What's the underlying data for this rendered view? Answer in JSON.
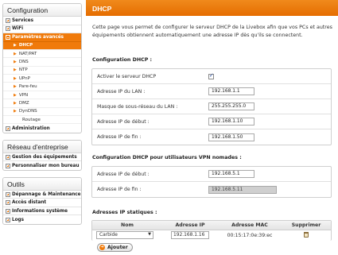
{
  "sidebar": {
    "config": {
      "title": "Configuration",
      "items": [
        {
          "label": "Services"
        },
        {
          "label": "WiFi"
        },
        {
          "label": "Paramètres avancés"
        }
      ],
      "subitems": [
        {
          "label": "DHCP"
        },
        {
          "label": "NAT/PAT"
        },
        {
          "label": "DNS"
        },
        {
          "label": "NTP"
        },
        {
          "label": "UPnP"
        },
        {
          "label": "Pare-feu"
        },
        {
          "label": "VPN"
        },
        {
          "label": "DMZ"
        },
        {
          "label": "DynDNS"
        },
        {
          "label": "Routage"
        }
      ],
      "admin": {
        "label": "Administration"
      }
    },
    "enterprise": {
      "title": "Réseau d'entreprise",
      "items": [
        {
          "label": "Gestion des équipements"
        },
        {
          "label": "Personnaliser mon bureau"
        }
      ]
    },
    "tools": {
      "title": "Outils",
      "items": [
        {
          "label": "Dépannage & Maintenance"
        },
        {
          "label": "Accès distant"
        },
        {
          "label": "Informations système"
        },
        {
          "label": "Logs"
        }
      ]
    }
  },
  "main": {
    "header": "DHCP",
    "intro": "Cette page vous permet de configurer le serveur DHCP de la Livebox afin que vos PCs et autres équipements obtiennent automatiquement une adresse IP dès qu'ils se connectent.",
    "dhcp": {
      "title": "Configuration DHCP :",
      "enable_label": "Activer le serveur DHCP",
      "lan_ip_label": "Adresse IP du LAN :",
      "lan_ip_value": "192.168.1.1",
      "mask_label": "Masque de sous-réseau du LAN :",
      "mask_value": "255.255.255.0",
      "start_label": "Adresse IP de début :",
      "start_value": "192.168.1.10",
      "end_label": "Adresse IP de fin :",
      "end_value": "192.168.1.50"
    },
    "vpn": {
      "title": "Configuration DHCP pour utilisateurs VPN nomades :",
      "start_label": "Adresse IP de début :",
      "start_value": "192.168.5.1",
      "end_label": "Adresse IP de fin :",
      "end_value": "192.168.5.11"
    },
    "static": {
      "title": "Adresses IP statiques :",
      "headers": {
        "name": "Nom",
        "ip": "Adresse IP",
        "mac": "Adresse MAC",
        "delete": "Supprimer"
      },
      "rows": [
        {
          "name": "Carbide",
          "ip": "192.168.1.16",
          "mac": "00:15:17:0e:39:ec"
        }
      ],
      "add_label": "Ajouter"
    }
  },
  "colors": {
    "accent": "#f07a0a",
    "header": "#e96f00"
  }
}
